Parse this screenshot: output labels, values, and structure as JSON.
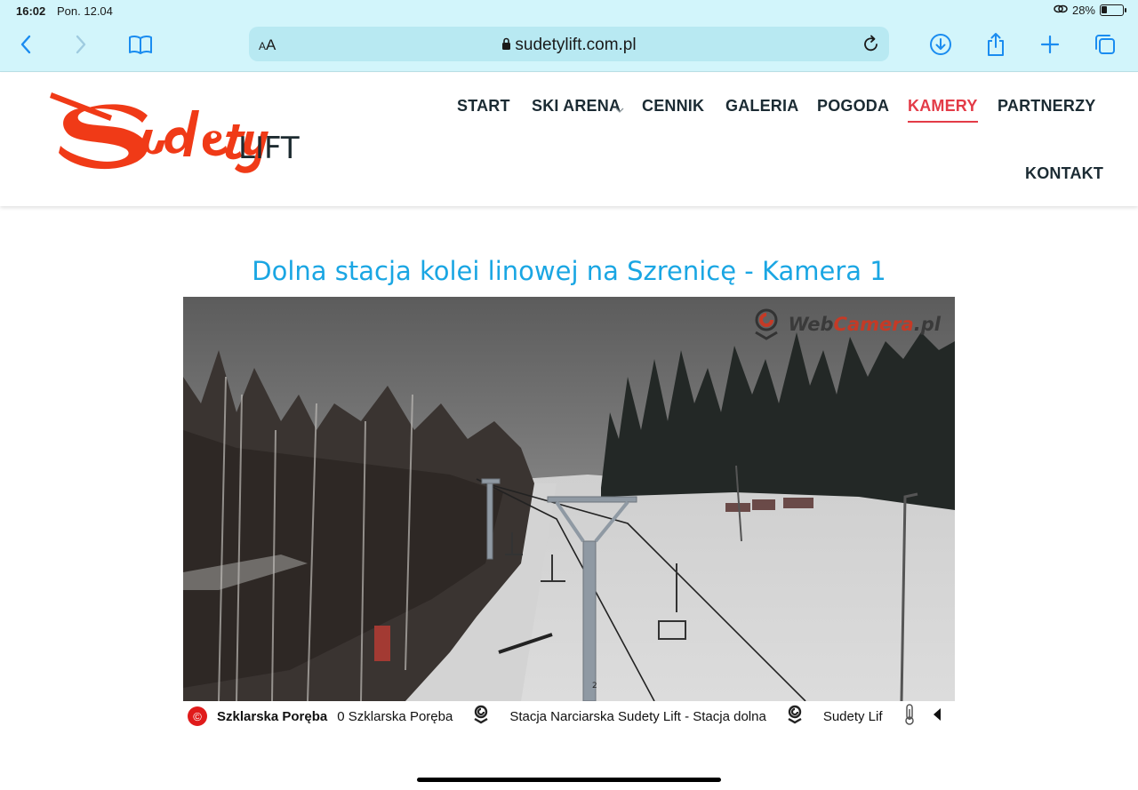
{
  "status": {
    "time": "16:02",
    "date": "Pon. 12.04",
    "battery": "28%",
    "battery_level": 0.28
  },
  "browser": {
    "aa_label": "AA",
    "url": "sudetylift.com.pl"
  },
  "site": {
    "logo": {
      "script": "Sudety",
      "word": "LIFT"
    },
    "nav": [
      {
        "label": "START"
      },
      {
        "label": "SKI ARENA"
      },
      {
        "label": "CENNIK"
      },
      {
        "label": "GALERIA"
      },
      {
        "label": "POGODA"
      },
      {
        "label": "KAMERY"
      },
      {
        "label": "PARTNERZY"
      },
      {
        "label": "KONTAKT"
      }
    ],
    "title": "Dolna stacja kolei linowej na Szrenicę - Kamera 1"
  },
  "camera": {
    "brand_a": "Web",
    "brand_b": "Camera",
    "brand_c": ".pl",
    "pole_number": "2",
    "ticker": {
      "location": "Szklarska Poręba",
      "item1": "0 Szklarska Poręba",
      "item2": "Stacja Narciarska Sudety Lift - Stacja dolna",
      "item3": "Sudety Lif"
    }
  },
  "colors": {
    "accent": "#1aa6e3",
    "active_nav": "#e33b47",
    "logo_red": "#f03a17",
    "chrome_bg": "#d2f5fb"
  }
}
